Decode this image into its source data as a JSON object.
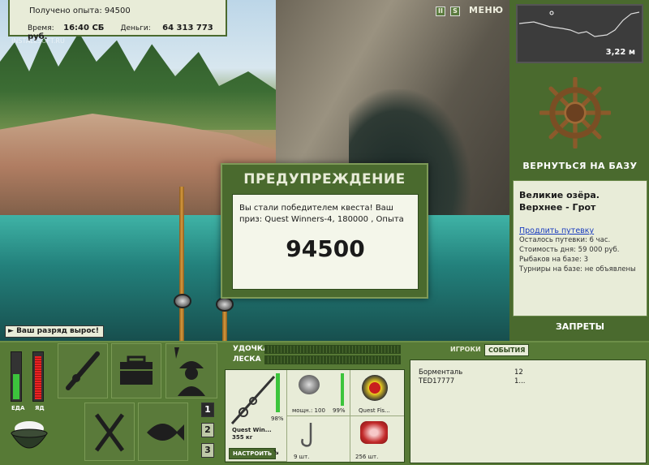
{
  "top_info": {
    "experience_text": "Получено опыта: 94500",
    "time_label": "Время:",
    "time_value": "16:40 СБ",
    "money_label": "Деньги:",
    "money_value": "64 313 773 руб."
  },
  "watermark": "INSTALLSOFT.RU",
  "top_buttons": {
    "pause": "II",
    "sound": "S",
    "menu": "МЕНЮ"
  },
  "depth_map": {
    "depth": "3,22 м"
  },
  "right_panel": {
    "back_to_base": "ВЕРНУТЬСЯ НА БАЗУ",
    "location_name": "Великие озёра. Верхнее - Грот",
    "extend_link": "Продлить путевку",
    "info_lines": [
      "Осталось путевки: 6 час.",
      "Стоимость дня: 59 000 руб.",
      "Рыбаков на базе: 3",
      "Турниры на базе: не объявлены"
    ],
    "bans": "ЗАПРЕТЫ"
  },
  "dialog": {
    "title": "ПРЕДУПРЕЖДЕНИЕ",
    "message": "Вы стали победителем квеста! Ваш приз: Quest Winners-4, 180000 , Опыта",
    "value": "94500"
  },
  "rank_notice": "Ваш разряд вырос!",
  "meters": {
    "food_label": "ЕДА",
    "poison_label": "ЯД",
    "food_level": 0.55,
    "poison_level": 0.95
  },
  "side_numbers": [
    "1",
    "2",
    "3"
  ],
  "tackle_bars": {
    "rod_label": "УДОЧКА",
    "line_label": "ЛЕСКА"
  },
  "tackle": {
    "rod_name": "Quest Win...",
    "rod_weight": "355 кг",
    "rod_percent": "98%",
    "setup_button": "НАСТРОИТЬ",
    "reel_power": "мощн.: 100",
    "reel_percent": "99%",
    "line_name": "Quest Fis...",
    "hook_count": "9 шт.",
    "bait_count": "256 шт."
  },
  "event_tabs": {
    "games": "ИГРОКИ",
    "events": "СОБЫТИЯ"
  },
  "events": [
    {
      "name": "Борменталь",
      "value": "12"
    },
    {
      "name": "TED17777",
      "value": "1..."
    }
  ],
  "colors": {
    "panel_green": "#4a6a2e",
    "panel_light": "#e8ecd8",
    "link": "#1a3cbf"
  }
}
